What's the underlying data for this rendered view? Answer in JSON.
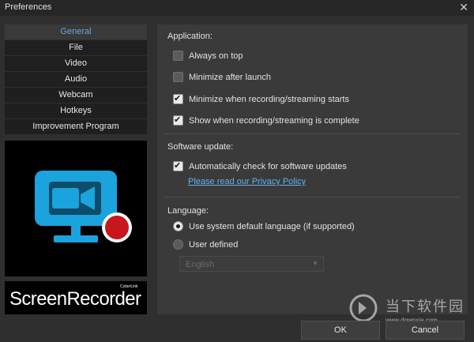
{
  "window": {
    "title": "Preferences",
    "close_glyph": "✕"
  },
  "sidebar": {
    "items": [
      {
        "label": "General",
        "active": true
      },
      {
        "label": "File",
        "active": false
      },
      {
        "label": "Video",
        "active": false
      },
      {
        "label": "Audio",
        "active": false
      },
      {
        "label": "Webcam",
        "active": false
      },
      {
        "label": "Hotkeys",
        "active": false
      },
      {
        "label": "Improvement Program",
        "active": false
      }
    ]
  },
  "product": {
    "brand_small": "CyberLink",
    "name": "ScreenRecorder",
    "logo_icon": "monitor-camera-record-icon"
  },
  "application": {
    "title": "Application:",
    "options": [
      {
        "label": "Always on top",
        "checked": false
      },
      {
        "label": "Minimize after launch",
        "checked": false
      },
      {
        "label": "Minimize when recording/streaming starts",
        "checked": true
      },
      {
        "label": "Show when recording/streaming is complete",
        "checked": true
      }
    ]
  },
  "software_update": {
    "title": "Software update:",
    "auto_check_label": "Automatically check for software updates",
    "auto_check_checked": true,
    "privacy_link": "Please read our Privacy Policy"
  },
  "language": {
    "title": "Language:",
    "options": [
      {
        "label": "Use system default language (if supported)",
        "selected": true
      },
      {
        "label": "User defined",
        "selected": false
      }
    ],
    "dropdown_value": "English",
    "dropdown_caret": "▼"
  },
  "buttons": {
    "ok": "OK",
    "cancel": "Cancel"
  },
  "watermark": {
    "title": "当下软件园",
    "url": "www.downxia.com"
  },
  "colors": {
    "accent": "#63a9e2",
    "link": "#62b1ea",
    "logo_blue": "#1aa3dc",
    "record_red": "#c8161d"
  }
}
